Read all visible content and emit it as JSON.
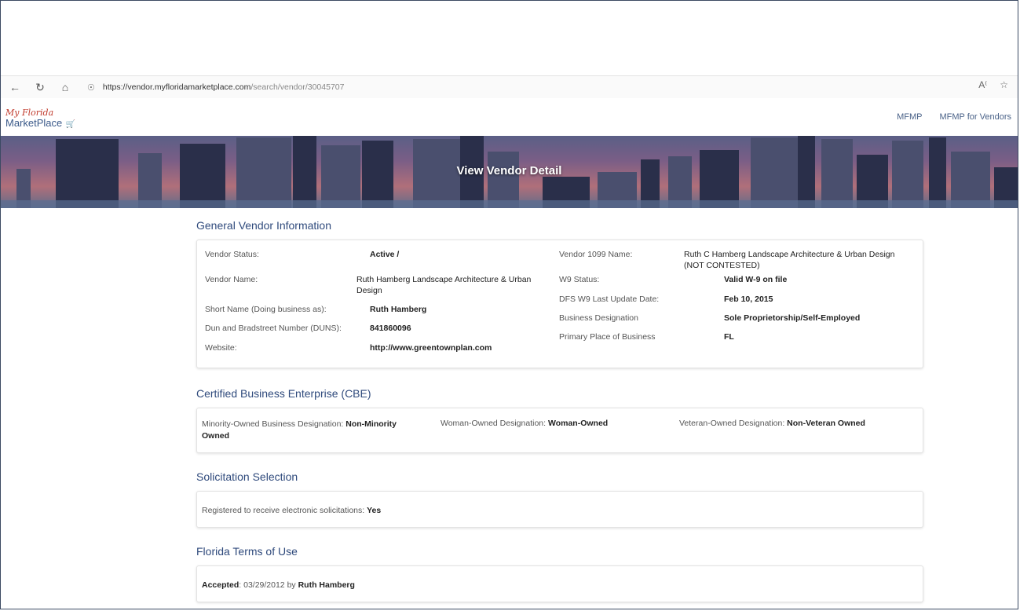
{
  "browser": {
    "url_host": "https://vendor.myfloridamarketplace.com",
    "url_path": "/search/vendor/30045707"
  },
  "logo": {
    "line1": "My Florida",
    "line2": "MarketPlace"
  },
  "topnav": {
    "link1": "MFMP",
    "link2": "MFMP for Vendors"
  },
  "banner": {
    "title": "View Vendor Detail"
  },
  "general": {
    "title": "General Vendor Information",
    "vendor_status_label": "Vendor Status:",
    "vendor_status": "Active /",
    "vendor_name_label": "Vendor Name:",
    "vendor_name_line1": "Ruth Hamberg Landscape Architecture & Urban",
    "vendor_name_line2": "Design",
    "short_name_label": "Short Name (Doing business as):",
    "short_name": "Ruth Hamberg",
    "duns_label": "Dun and Bradstreet Number (DUNS):",
    "duns": "841860096",
    "website_label": "Website:",
    "website": "http://www.greentownplan.com",
    "v1099_label": "Vendor 1099 Name:",
    "v1099_line1": "Ruth C Hamberg Landscape Architecture & Urban Design",
    "v1099_line2": "(NOT CONTESTED)",
    "w9_label": "W9 Status:",
    "w9": "Valid W-9 on file",
    "dfs_label": "DFS W9 Last Update Date:",
    "dfs": "Feb 10, 2015",
    "bizdes_label": "Business Designation",
    "bizdes": "Sole Proprietorship/Self-Employed",
    "ppb_label": "Primary Place of Business",
    "ppb": "FL"
  },
  "cbe": {
    "title": "Certified Business Enterprise (CBE)",
    "minority_label": "Minority-Owned Business Designation:",
    "minority_val1": "Non-Minority",
    "minority_val2": "Owned",
    "woman_label": "Woman-Owned Designation:",
    "woman_val": "Woman-Owned",
    "veteran_label": "Veteran-Owned Designation:",
    "veteran_val": "Non-Veteran Owned"
  },
  "solicitation": {
    "title": "Solicitation Selection",
    "label": "Registered to receive electronic solicitations:",
    "value": "Yes"
  },
  "terms": {
    "title": "Florida Terms of Use",
    "accepted_label": "Accepted",
    "date_text": ": 03/29/2012 by",
    "by_name": "Ruth Hamberg"
  }
}
